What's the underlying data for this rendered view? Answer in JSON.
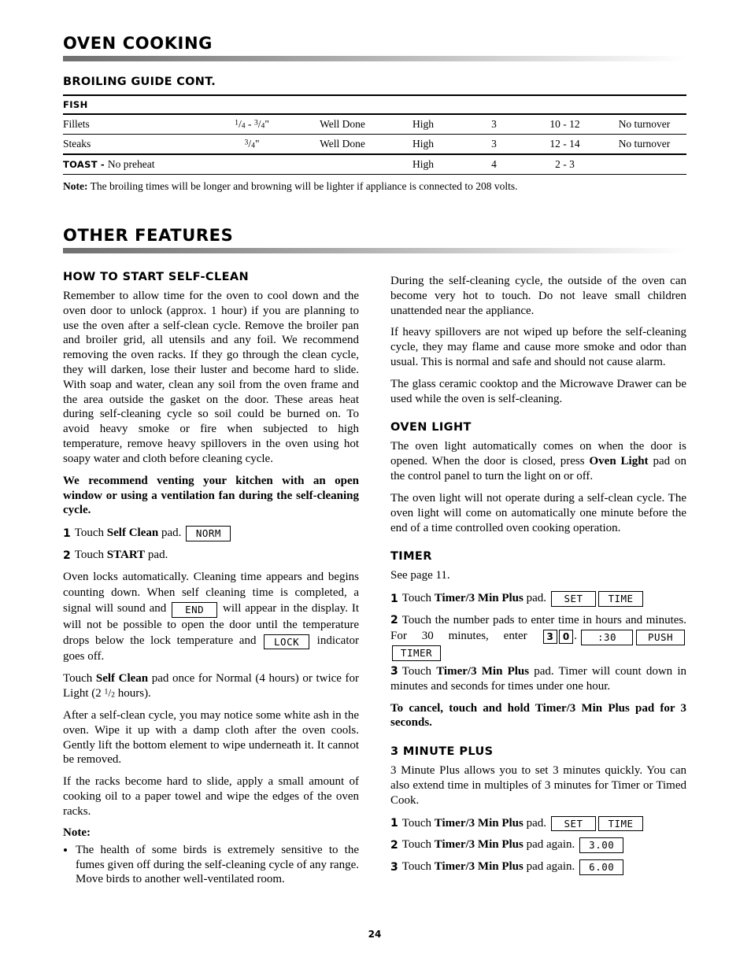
{
  "page_number": "24",
  "section_oven_cooking": {
    "title": "OVEN COOKING",
    "subtitle": "BROILING GUIDE CONT."
  },
  "broiling_table": {
    "group_header": "FISH",
    "rows": [
      {
        "food": "Fillets",
        "thickness_num1": "1",
        "thickness_den1": "4",
        "thickness_sep": " - ",
        "thickness_num2": "3",
        "thickness_den2": "4",
        "thickness_suffix": "\"",
        "doneness": "Well Done",
        "setting": "High",
        "rack": "3",
        "time": "10 - 12",
        "note": "No turnover"
      },
      {
        "food": "Steaks",
        "thickness_num1": "",
        "thickness_den1": "",
        "thickness_sep": "",
        "thickness_num2": "3",
        "thickness_den2": "4",
        "thickness_suffix": "\"",
        "doneness": "Well Done",
        "setting": "High",
        "rack": "3",
        "time": "12 - 14",
        "note": "No turnover"
      }
    ],
    "toast_row": {
      "label": "TOAST",
      "separator": "-",
      "detail": "No preheat",
      "setting": "High",
      "rack": "4",
      "time": "2 - 3",
      "note": ""
    },
    "footnote_label": "Note:",
    "footnote_text": " The broiling times will be longer and browning will be lighter if appliance is connected to 208 volts."
  },
  "section_other_features": {
    "title": "OTHER FEATURES"
  },
  "self_clean": {
    "heading": "HOW TO START SELF-CLEAN",
    "para1": "Remember to allow time for the oven to cool down and the oven door to unlock (approx. 1 hour) if you are planning to use the oven after a self-clean cycle. Remove the broiler pan and broiler grid, all utensils and any foil. We recommend removing the oven racks. If they go through the clean cycle, they will darken, lose their luster and become hard to slide. With soap and water, clean any soil from the oven frame and the area outside the gasket on the door. These areas heat during self-cleaning cycle so soil could be burned on. To avoid heavy smoke or fire when subjected to high temperature, remove heavy spillovers in the oven using hot soapy water and cloth before cleaning cycle.",
    "warning": "We recommend venting your kitchen with an open window or using a ventilation fan during the self-cleaning cycle.",
    "step1_num": "1",
    "step1_pre": "Touch ",
    "step1_bold": "Self Clean",
    "step1_post": " pad.",
    "step1_display": "NORM",
    "step2_num": "2",
    "step2_pre": "Touch ",
    "step2_bold": "START",
    "step2_post": " pad.",
    "para_lock_a": "Oven locks automatically. Cleaning time appears and begins counting down. When self cleaning time is completed, a signal will sound and ",
    "display_end": "END",
    "para_lock_b": " will appear in the display. It will not be possible to open the door until the temperature drops below the lock temperature and ",
    "display_lock": "LOCK",
    "para_lock_c": " indicator goes off.",
    "para_normal_pre": "Touch ",
    "para_normal_bold": "Self Clean",
    "para_normal_post": " pad once for Normal (4 hours) or twice for Light (2 ",
    "para_normal_frac_num": "1",
    "para_normal_frac_den": "2",
    "para_normal_tail": " hours).",
    "para_ash": "After a self-clean cycle, you may notice some white ash in the oven. Wipe it up with a damp cloth after the oven cools. Gently lift the bottom element to wipe underneath it. It cannot be removed.",
    "para_racks": "If the racks become hard to slide, apply a small amount of cooking oil to a paper towel and wipe the edges of the oven racks.",
    "note_header": "Note:",
    "note_bullets": [
      "The health of some birds is extremely sensitive to the fumes given off during the self-cleaning cycle of any range. Move birds to another well-ventilated room."
    ]
  },
  "right_column": {
    "para_hot": "During the self-cleaning cycle, the outside of the oven can become very hot to touch. Do not leave small children unattended near the appliance.",
    "para_spill": "If heavy spillovers are not wiped up before the self-cleaning cycle, they may flame and cause more smoke and odor than usual. This is normal and safe and should not cause alarm.",
    "para_cooktop": "The glass ceramic cooktop and the Microwave Drawer can be used while the oven is self-cleaning."
  },
  "oven_light": {
    "heading": "OVEN LIGHT",
    "para1_a": "The oven light automatically comes on when the door is opened. When the door is closed, press ",
    "para1_bold": "Oven Light",
    "para1_b": " pad on the control panel to turn the light on or off.",
    "para2": "The oven light will not operate during a self-clean cycle. The oven light will come on automatically one minute before the end of a time controlled oven cooking operation."
  },
  "timer": {
    "heading": "TIMER",
    "see_page": "See page 11.",
    "step1_num": "1",
    "step1_pre": "Touch ",
    "step1_bold": "Timer/3 Min Plus",
    "step1_post": " pad.",
    "step1_display_a": "SET",
    "step1_display_b": "TIME",
    "step2_num": "2",
    "step2_text_a": "Touch the number pads to enter time in hours and minutes. For 30 minutes, enter ",
    "step2_key_a": "3",
    "step2_key_b": "0",
    "step2_text_b": ".",
    "step2_display_a": ":30",
    "step2_display_b": "PUSH",
    "step2_display_c": "TIMER",
    "step3_num": "3",
    "step3_pre": "Touch ",
    "step3_bold": "Timer/3 Min Plus",
    "step3_post": " pad. Timer will count down in minutes and seconds for times under one hour.",
    "cancel_note": "To cancel, touch and hold Timer/3 Min Plus pad for 3 seconds."
  },
  "three_min_plus": {
    "heading": "3 MINUTE PLUS",
    "para1": "3 Minute Plus allows you to set 3 minutes quickly. You can also extend time in multiples of 3 minutes for Timer or Timed Cook.",
    "step1_num": "1",
    "step1_pre": "Touch ",
    "step1_bold": "Timer/3 Min Plus",
    "step1_post": " pad.",
    "step1_display_a": "SET",
    "step1_display_b": "TIME",
    "step2_num": "2",
    "step2_pre": "Touch ",
    "step2_bold": "Timer/3 Min Plus",
    "step2_post": " pad again.",
    "step2_display": "3.00",
    "step3_num": "3",
    "step3_pre": "Touch ",
    "step3_bold": "Timer/3 Min Plus",
    "step3_post": " pad again.",
    "step3_display": "6.00"
  }
}
